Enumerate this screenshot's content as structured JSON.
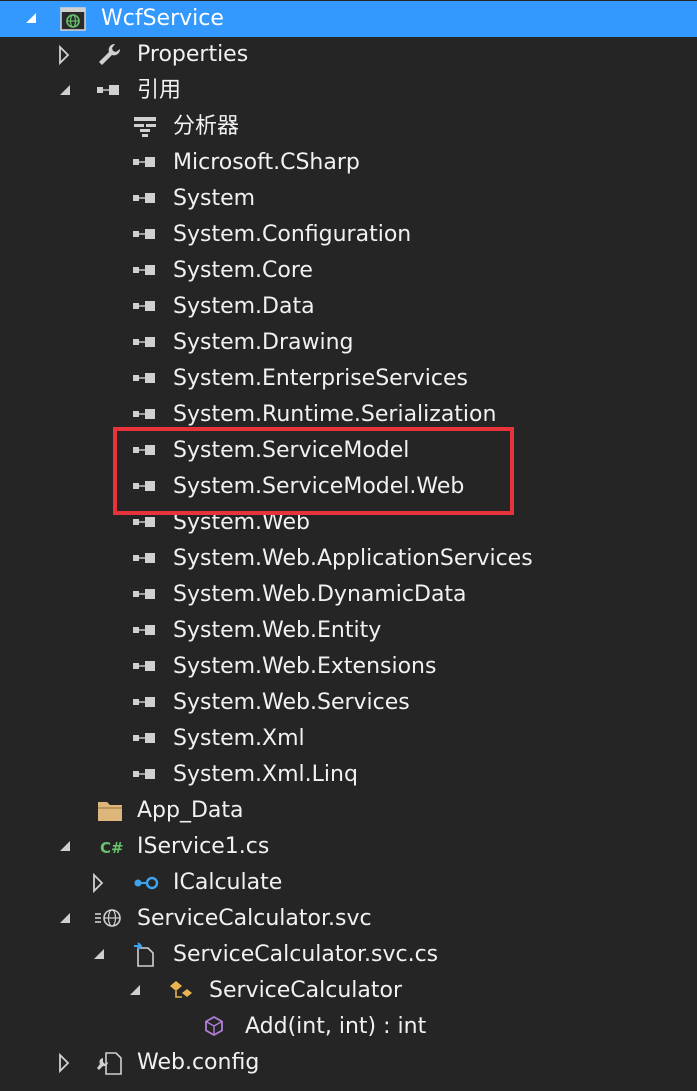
{
  "tree": {
    "project": "WcfService",
    "properties": "Properties",
    "references_folder": "引用",
    "analyzers": "分析器",
    "references": [
      "Microsoft.CSharp",
      "System",
      "System.Configuration",
      "System.Core",
      "System.Data",
      "System.Drawing",
      "System.EnterpriseServices",
      "System.Runtime.Serialization",
      "System.ServiceModel",
      "System.ServiceModel.Web",
      "System.Web",
      "System.Web.ApplicationServices",
      "System.Web.DynamicData",
      "System.Web.Entity",
      "System.Web.Extensions",
      "System.Web.Services",
      "System.Xml",
      "System.Xml.Linq"
    ],
    "app_data": "App_Data",
    "iservice_file": "IService1.cs",
    "icalculate": "ICalculate",
    "svc_file": "ServiceCalculator.svc",
    "svc_cs_file": "ServiceCalculator.svc.cs",
    "class_name": "ServiceCalculator",
    "method": "Add(int, int) : int",
    "web_config": "Web.config"
  },
  "highlighted_items": [
    "System.ServiceModel",
    "System.ServiceModel.Web"
  ],
  "colors": {
    "background": "#252526",
    "selection": "#3399ff",
    "text": "#f1f1f1",
    "highlight_border": "#e8333a",
    "csharp_green": "#68c26b",
    "interface_blue": "#3ea3f0",
    "method_purple": "#b180d7",
    "class_orange": "#e8b453",
    "folder_tan": "#dcb67a"
  }
}
